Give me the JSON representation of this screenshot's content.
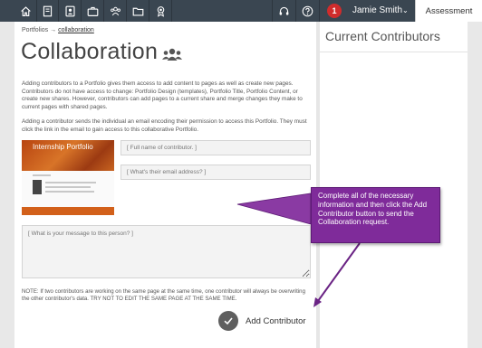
{
  "topbar": {
    "nav_icons": [
      "home-icon",
      "page-icon",
      "contact-card-icon",
      "briefcase-icon",
      "users-icon",
      "folder-icon",
      "award-icon"
    ],
    "notification_count": "1",
    "user_name": "Jamie Smith",
    "active_tab": "Assessment"
  },
  "breadcrumb": {
    "root": "Portfolios",
    "separator": "→",
    "current": "collaboration"
  },
  "page": {
    "title": "Collaboration",
    "intro_1": "Adding contributors to a Portfolio gives them access to add content to pages as well as create new pages. Contributors do not have access to change: Portfolio Design (templates), Portfolio Title, Portfolio Content, or create new shares. However, contributors can add pages to a current share and merge changes they make to current pages with shared pages.",
    "intro_2": "Adding a contributor sends the individual an email encoding their permission to access this Portfolio. They must click the link in the email to gain access to this collaborative Portfolio."
  },
  "thumbnail": {
    "title": "Internship Portfolio"
  },
  "form": {
    "name_placeholder": "[ Full name of contributor. ]",
    "email_placeholder": "[ What's their email address? ]",
    "message_placeholder": "[ What is your message to this person? ]",
    "note": "NOTE: If two contributors are working on the same page at the same time, one contributor will always be overwriting the other contributor's data. TRY NOT TO EDIT THE SAME PAGE AT THE SAME TIME.",
    "add_button": "Add Contributor"
  },
  "sidebar": {
    "title": "Current Contributors"
  },
  "callout": {
    "text": "Complete all of the necessary information and then click the Add Contributor button to send the Collaboration request."
  },
  "colors": {
    "topbar": "#3a4651",
    "badge": "#d02c2c",
    "callout": "#7f2b9a",
    "thumb_accent": "#d2601a"
  }
}
